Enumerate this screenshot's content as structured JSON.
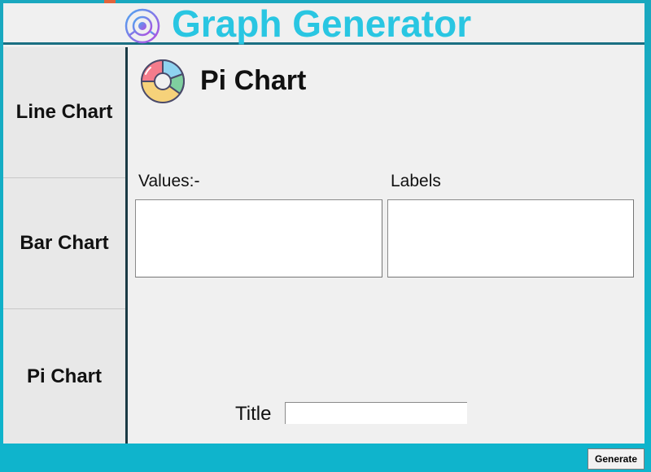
{
  "header": {
    "title": "Graph Generator",
    "logo_icon": "chart-logo-icon",
    "title_color": "#29c6e2"
  },
  "sidebar": {
    "items": [
      {
        "label": "Line Chart"
      },
      {
        "label": "Bar Chart"
      },
      {
        "label": "Pi Chart"
      }
    ]
  },
  "main": {
    "page_title": "Pi Chart",
    "page_icon": "pie-chart-icon",
    "values_label": "Values:-",
    "values_text": "",
    "labels_label": "Labels",
    "labels_text": "",
    "title_label": "Title",
    "title_value": ""
  },
  "footer": {
    "generate_label": "Generate"
  },
  "colors": {
    "desktop_background": "#10b0c8",
    "window_background": "#f0f0f0",
    "header_divider": "#1a6f82"
  }
}
